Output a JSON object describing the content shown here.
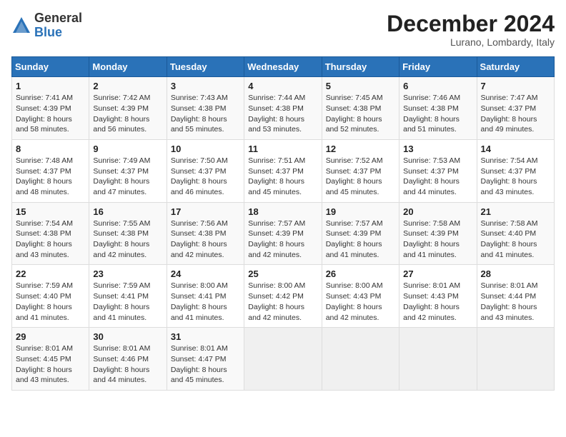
{
  "header": {
    "logo_general": "General",
    "logo_blue": "Blue",
    "month_title": "December 2024",
    "subtitle": "Lurano, Lombardy, Italy"
  },
  "columns": [
    "Sunday",
    "Monday",
    "Tuesday",
    "Wednesday",
    "Thursday",
    "Friday",
    "Saturday"
  ],
  "weeks": [
    [
      {
        "day": "1",
        "sunrise": "Sunrise: 7:41 AM",
        "sunset": "Sunset: 4:39 PM",
        "daylight": "Daylight: 8 hours and 58 minutes."
      },
      {
        "day": "2",
        "sunrise": "Sunrise: 7:42 AM",
        "sunset": "Sunset: 4:39 PM",
        "daylight": "Daylight: 8 hours and 56 minutes."
      },
      {
        "day": "3",
        "sunrise": "Sunrise: 7:43 AM",
        "sunset": "Sunset: 4:38 PM",
        "daylight": "Daylight: 8 hours and 55 minutes."
      },
      {
        "day": "4",
        "sunrise": "Sunrise: 7:44 AM",
        "sunset": "Sunset: 4:38 PM",
        "daylight": "Daylight: 8 hours and 53 minutes."
      },
      {
        "day": "5",
        "sunrise": "Sunrise: 7:45 AM",
        "sunset": "Sunset: 4:38 PM",
        "daylight": "Daylight: 8 hours and 52 minutes."
      },
      {
        "day": "6",
        "sunrise": "Sunrise: 7:46 AM",
        "sunset": "Sunset: 4:38 PM",
        "daylight": "Daylight: 8 hours and 51 minutes."
      },
      {
        "day": "7",
        "sunrise": "Sunrise: 7:47 AM",
        "sunset": "Sunset: 4:37 PM",
        "daylight": "Daylight: 8 hours and 49 minutes."
      }
    ],
    [
      {
        "day": "8",
        "sunrise": "Sunrise: 7:48 AM",
        "sunset": "Sunset: 4:37 PM",
        "daylight": "Daylight: 8 hours and 48 minutes."
      },
      {
        "day": "9",
        "sunrise": "Sunrise: 7:49 AM",
        "sunset": "Sunset: 4:37 PM",
        "daylight": "Daylight: 8 hours and 47 minutes."
      },
      {
        "day": "10",
        "sunrise": "Sunrise: 7:50 AM",
        "sunset": "Sunset: 4:37 PM",
        "daylight": "Daylight: 8 hours and 46 minutes."
      },
      {
        "day": "11",
        "sunrise": "Sunrise: 7:51 AM",
        "sunset": "Sunset: 4:37 PM",
        "daylight": "Daylight: 8 hours and 45 minutes."
      },
      {
        "day": "12",
        "sunrise": "Sunrise: 7:52 AM",
        "sunset": "Sunset: 4:37 PM",
        "daylight": "Daylight: 8 hours and 45 minutes."
      },
      {
        "day": "13",
        "sunrise": "Sunrise: 7:53 AM",
        "sunset": "Sunset: 4:37 PM",
        "daylight": "Daylight: 8 hours and 44 minutes."
      },
      {
        "day": "14",
        "sunrise": "Sunrise: 7:54 AM",
        "sunset": "Sunset: 4:37 PM",
        "daylight": "Daylight: 8 hours and 43 minutes."
      }
    ],
    [
      {
        "day": "15",
        "sunrise": "Sunrise: 7:54 AM",
        "sunset": "Sunset: 4:38 PM",
        "daylight": "Daylight: 8 hours and 43 minutes."
      },
      {
        "day": "16",
        "sunrise": "Sunrise: 7:55 AM",
        "sunset": "Sunset: 4:38 PM",
        "daylight": "Daylight: 8 hours and 42 minutes."
      },
      {
        "day": "17",
        "sunrise": "Sunrise: 7:56 AM",
        "sunset": "Sunset: 4:38 PM",
        "daylight": "Daylight: 8 hours and 42 minutes."
      },
      {
        "day": "18",
        "sunrise": "Sunrise: 7:57 AM",
        "sunset": "Sunset: 4:39 PM",
        "daylight": "Daylight: 8 hours and 42 minutes."
      },
      {
        "day": "19",
        "sunrise": "Sunrise: 7:57 AM",
        "sunset": "Sunset: 4:39 PM",
        "daylight": "Daylight: 8 hours and 41 minutes."
      },
      {
        "day": "20",
        "sunrise": "Sunrise: 7:58 AM",
        "sunset": "Sunset: 4:39 PM",
        "daylight": "Daylight: 8 hours and 41 minutes."
      },
      {
        "day": "21",
        "sunrise": "Sunrise: 7:58 AM",
        "sunset": "Sunset: 4:40 PM",
        "daylight": "Daylight: 8 hours and 41 minutes."
      }
    ],
    [
      {
        "day": "22",
        "sunrise": "Sunrise: 7:59 AM",
        "sunset": "Sunset: 4:40 PM",
        "daylight": "Daylight: 8 hours and 41 minutes."
      },
      {
        "day": "23",
        "sunrise": "Sunrise: 7:59 AM",
        "sunset": "Sunset: 4:41 PM",
        "daylight": "Daylight: 8 hours and 41 minutes."
      },
      {
        "day": "24",
        "sunrise": "Sunrise: 8:00 AM",
        "sunset": "Sunset: 4:41 PM",
        "daylight": "Daylight: 8 hours and 41 minutes."
      },
      {
        "day": "25",
        "sunrise": "Sunrise: 8:00 AM",
        "sunset": "Sunset: 4:42 PM",
        "daylight": "Daylight: 8 hours and 42 minutes."
      },
      {
        "day": "26",
        "sunrise": "Sunrise: 8:00 AM",
        "sunset": "Sunset: 4:43 PM",
        "daylight": "Daylight: 8 hours and 42 minutes."
      },
      {
        "day": "27",
        "sunrise": "Sunrise: 8:01 AM",
        "sunset": "Sunset: 4:43 PM",
        "daylight": "Daylight: 8 hours and 42 minutes."
      },
      {
        "day": "28",
        "sunrise": "Sunrise: 8:01 AM",
        "sunset": "Sunset: 4:44 PM",
        "daylight": "Daylight: 8 hours and 43 minutes."
      }
    ],
    [
      {
        "day": "29",
        "sunrise": "Sunrise: 8:01 AM",
        "sunset": "Sunset: 4:45 PM",
        "daylight": "Daylight: 8 hours and 43 minutes."
      },
      {
        "day": "30",
        "sunrise": "Sunrise: 8:01 AM",
        "sunset": "Sunset: 4:46 PM",
        "daylight": "Daylight: 8 hours and 44 minutes."
      },
      {
        "day": "31",
        "sunrise": "Sunrise: 8:01 AM",
        "sunset": "Sunset: 4:47 PM",
        "daylight": "Daylight: 8 hours and 45 minutes."
      },
      null,
      null,
      null,
      null
    ]
  ]
}
